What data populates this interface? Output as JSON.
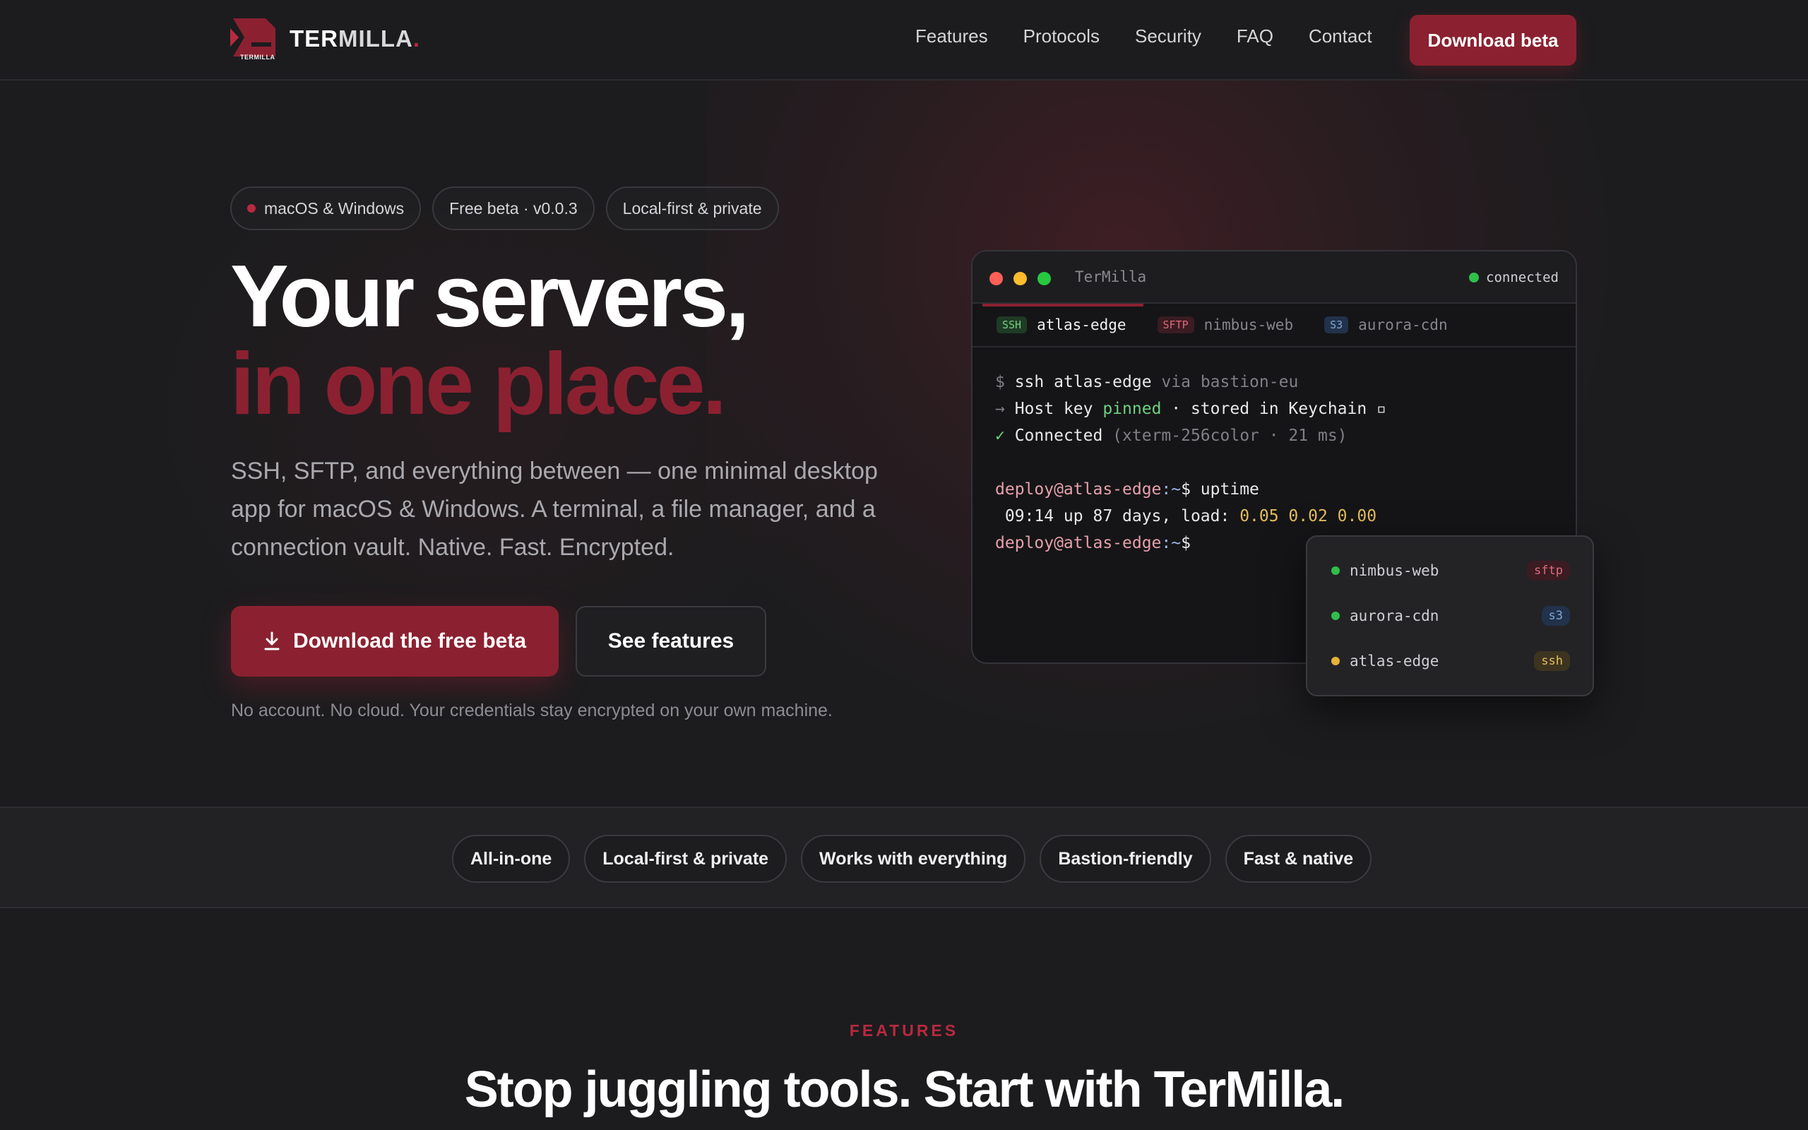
{
  "nav": {
    "brand_part1": "TER",
    "brand_part2": "MILLA",
    "brand_dot": ".",
    "logo_small_text": "TERMILLA",
    "links": [
      "Features",
      "Protocols",
      "Security",
      "FAQ",
      "Contact"
    ],
    "cta": "Download beta"
  },
  "hero": {
    "badges": [
      "macOS & Windows",
      "Free beta · v0.0.3",
      "Local-first & private"
    ],
    "headline_line1": "Your servers,",
    "headline_line2": "in one place.",
    "lead": "SSH, SFTP, and everything between — one minimal desktop app for macOS & Windows. A terminal, a file manager, and a connection vault. Native. Fast. Encrypted.",
    "primary_button": "Download the free beta",
    "secondary_button": "See features",
    "fine_print": "No account. No cloud. Your credentials stay encrypted on your own machine."
  },
  "terminal": {
    "title": "TerMilla",
    "status": "connected",
    "tabs": [
      {
        "chip": "SSH",
        "label": "atlas-edge"
      },
      {
        "chip": "SFTP",
        "label": "nimbus-web"
      },
      {
        "chip": "S3",
        "label": "aurora-cdn"
      }
    ],
    "lines": {
      "l1_prompt": "$ ",
      "l1_cmd": "ssh atlas-edge",
      "l1_via": " via bastion-eu",
      "l2_arrow": "→ ",
      "l2_a": "Host key ",
      "l2_pinned": "pinned",
      "l2_b": " · stored in Keychain ▫",
      "l3_check": "✓ ",
      "l3_a": "Connected",
      "l3_b": " (xterm-256color · 21 ms)",
      "l5_user": "deploy@atlas-edge",
      "l5_path": ":~",
      "l5_cmd": "$ uptime",
      "l6_a": " 09:14 up 87 days, load: ",
      "l6_load": "0.05 0.02 0.00",
      "l7_user": "deploy@atlas-edge",
      "l7_path": ":~",
      "l7_prompt": "$"
    }
  },
  "quick_switcher": [
    {
      "name": "nimbus-web",
      "tag": "sftp",
      "dot_color": "#2fbf4a"
    },
    {
      "name": "aurora-cdn",
      "tag": "s3",
      "dot_color": "#2fbf4a"
    },
    {
      "name": "atlas-edge",
      "tag": "ssh",
      "dot_color": "#e6b23a"
    }
  ],
  "feature_pills": [
    "All-in-one",
    "Local-first & private",
    "Works with everything",
    "Bastion-friendly",
    "Fast & native"
  ],
  "features_section": {
    "eyebrow": "FEATURES",
    "heading": "Stop juggling tools. Start with TerMilla."
  },
  "colors": {
    "accent": "#8b2130",
    "background": "#1c1c1e",
    "status_green": "#2fbf4a"
  }
}
